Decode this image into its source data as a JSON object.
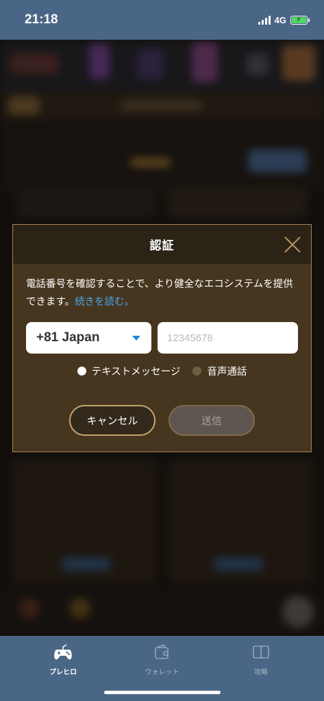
{
  "status_bar": {
    "time": "21:18",
    "network": "4G",
    "battery_charging": true,
    "battery_color": "#4cd964"
  },
  "dialog": {
    "title": "認証",
    "close_icon": "close-icon",
    "description": "電話番号を確認することで、より健全なエコシステムを提供できます。",
    "read_more": "続きを読む。",
    "link_color": "#4aa5ee",
    "country_code": "+81 Japan",
    "phone_placeholder": "12345678",
    "phone_value": "",
    "verification_methods": [
      {
        "label": "テキストメッセージ",
        "selected": true
      },
      {
        "label": "音声通話",
        "selected": false
      }
    ],
    "cancel_label": "キャンセル",
    "send_label": "送信",
    "send_enabled": false
  },
  "tab_bar": {
    "items": [
      {
        "label": "プレヒロ",
        "icon": "gamepad-icon",
        "active": true
      },
      {
        "label": "ウォレット",
        "icon": "wallet-icon",
        "active": false
      },
      {
        "label": "攻略",
        "icon": "book-icon",
        "active": false
      }
    ]
  },
  "colors": {
    "bar_blue": "#4a6686",
    "dialog_brown": "#46361f",
    "accent_gold": "#c6a36b"
  }
}
